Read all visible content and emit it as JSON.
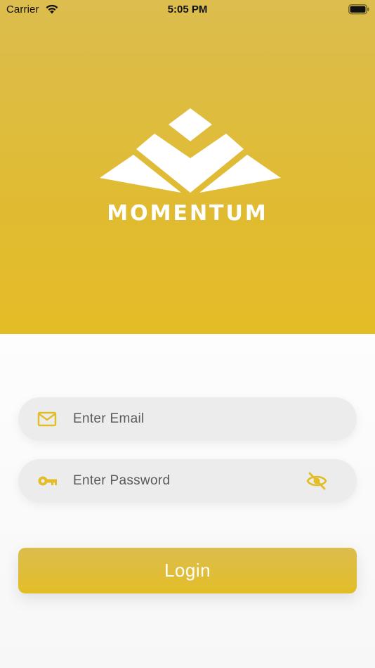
{
  "status_bar": {
    "carrier": "Carrier",
    "time": "5:05 PM"
  },
  "brand": {
    "name": "MOMENTUM",
    "accent_color": "#e3bd27"
  },
  "form": {
    "email_placeholder": "Enter Email",
    "password_placeholder": "Enter Password",
    "email_icon": "mail-icon",
    "password_icon": "key-icon",
    "visibility_icon": "eye-off-icon",
    "login_label": "Login"
  }
}
